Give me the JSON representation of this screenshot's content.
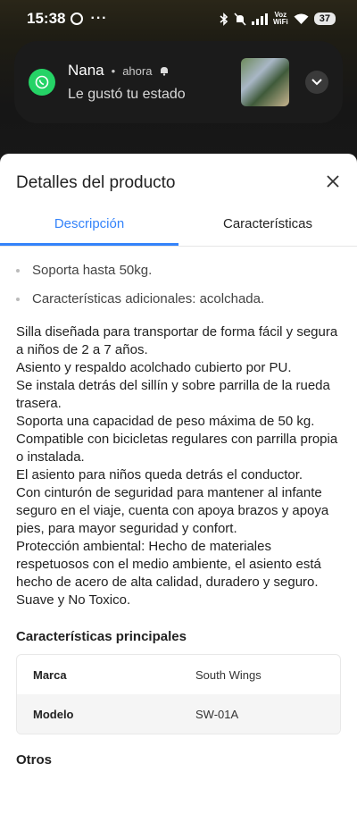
{
  "status_bar": {
    "time": "15:38",
    "dots": "···",
    "volte_top": "Voz",
    "volte_bottom": "WiFi",
    "battery": "37"
  },
  "notification": {
    "app_icon": "whatsapp-icon",
    "sender": "Nana",
    "time": "ahora",
    "message": "Le gustó tu estado"
  },
  "sheet": {
    "title": "Detalles del producto",
    "tabs": [
      {
        "label": "Descripción",
        "active": true
      },
      {
        "label": "Características",
        "active": false
      }
    ],
    "bullets": [
      "Soporta hasta 50kg.",
      "Características adicionales: acolchada."
    ],
    "description": [
      "Silla diseñada para transportar de forma fácil y segura a niños de 2 a 7 años.",
      "Asiento y respaldo acolchado cubierto por PU.",
      "Se instala detrás del sillín y sobre parrilla de la rueda trasera.",
      "Soporta una capacidad de peso máxima de 50 kg.",
      "Compatible con bicicletas regulares con parrilla propia o instalada.",
      "El asiento para niños queda detrás el conductor.",
      "Con cinturón de seguridad para mantener al infante seguro en el viaje, cuenta con apoya brazos y apoya pies, para mayor seguridad y confort.",
      "Protección ambiental: Hecho de materiales respetuosos con el medio ambiente, el asiento está hecho de acero de alta calidad, duradero y seguro.",
      "Suave y No Toxico."
    ],
    "main_features_title": "Características principales",
    "specs": [
      {
        "key": "Marca",
        "value": "South Wings"
      },
      {
        "key": "Modelo",
        "value": "SW-01A"
      }
    ],
    "others_title": "Otros"
  },
  "colors": {
    "accent": "#3483fa",
    "whatsapp": "#25d366"
  }
}
